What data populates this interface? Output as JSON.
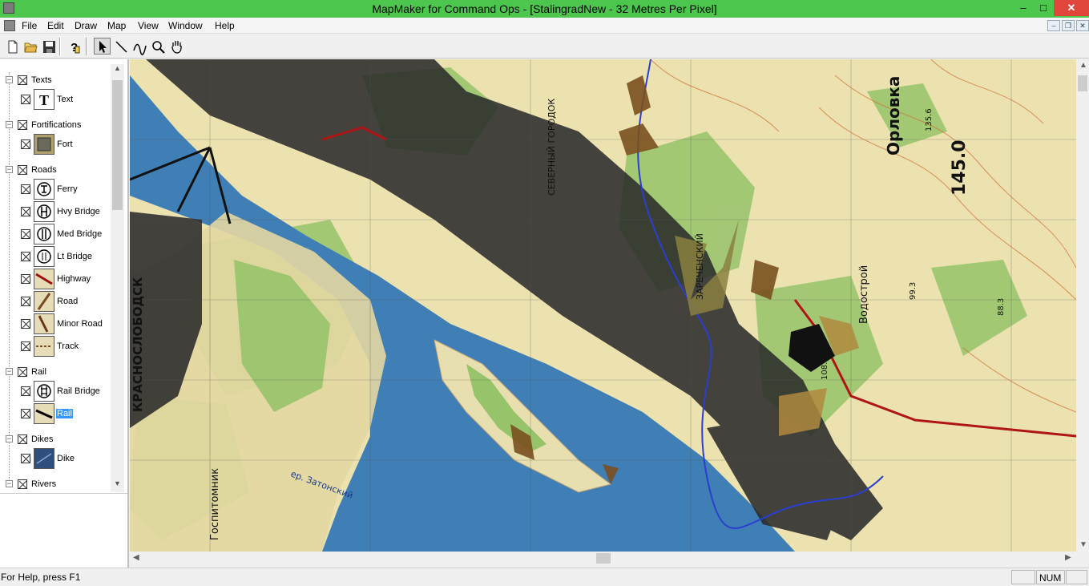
{
  "window": {
    "title": "MapMaker for Command Ops - [StalingradNew - 32 Metres Per Pixel]",
    "minimize": "–",
    "maximize": "□",
    "close": "✕"
  },
  "menu": [
    "File",
    "Edit",
    "Draw",
    "Map",
    "View",
    "Window",
    "Help"
  ],
  "toolbar": {
    "buttons": [
      "new-icon",
      "open-folder-icon",
      "save-icon",
      "help-icon",
      "select-arrow-icon",
      "line-icon",
      "curve-icon",
      "zoom-icon",
      "pan-hand-icon"
    ]
  },
  "tree": {
    "groups": [
      {
        "label": "Texts",
        "items": [
          {
            "label": "Text",
            "icon": "text-icon"
          }
        ]
      },
      {
        "label": "Fortifications",
        "items": [
          {
            "label": "Fort",
            "icon": "fort-icon"
          }
        ]
      },
      {
        "label": "Roads",
        "items": [
          {
            "label": "Ferry",
            "icon": "ferry-icon"
          },
          {
            "label": "Hvy Bridge",
            "icon": "heavy-bridge-icon"
          },
          {
            "label": "Med Bridge",
            "icon": "medium-bridge-icon"
          },
          {
            "label": "Lt Bridge",
            "icon": "light-bridge-icon"
          },
          {
            "label": "Highway",
            "icon": "highway-icon"
          },
          {
            "label": "Road",
            "icon": "road-icon"
          },
          {
            "label": "Minor Road",
            "icon": "minor-road-icon"
          },
          {
            "label": "Track",
            "icon": "track-icon"
          }
        ]
      },
      {
        "label": "Rail",
        "items": [
          {
            "label": "Rail Bridge",
            "icon": "rail-bridge-icon"
          },
          {
            "label": "Rail",
            "icon": "rail-icon",
            "selected": true
          }
        ]
      },
      {
        "label": "Dikes",
        "items": [
          {
            "label": "Dike",
            "icon": "dike-icon"
          }
        ]
      },
      {
        "label": "Rivers",
        "items": []
      }
    ]
  },
  "map": {
    "labels": {
      "orlovka": "Орловка",
      "elev_450": "145.0",
      "vodostroi": "Водострой",
      "zarechensky": "ЗАРЕЧЕНСКИЙ",
      "severny": "СЕВЕРНЫЙ ГОРОДОК",
      "krasnaya": "КРАСНОСЛОБОДСК",
      "gospitomnik": "Госпитомник",
      "zatonsky": "ер. Затонский",
      "elev_1088": "108.8",
      "elev_993": "99.3",
      "elev_883": "88.3",
      "elev_1356": "135.6"
    }
  },
  "status": {
    "help": "For Help, press F1",
    "num": "NUM"
  }
}
